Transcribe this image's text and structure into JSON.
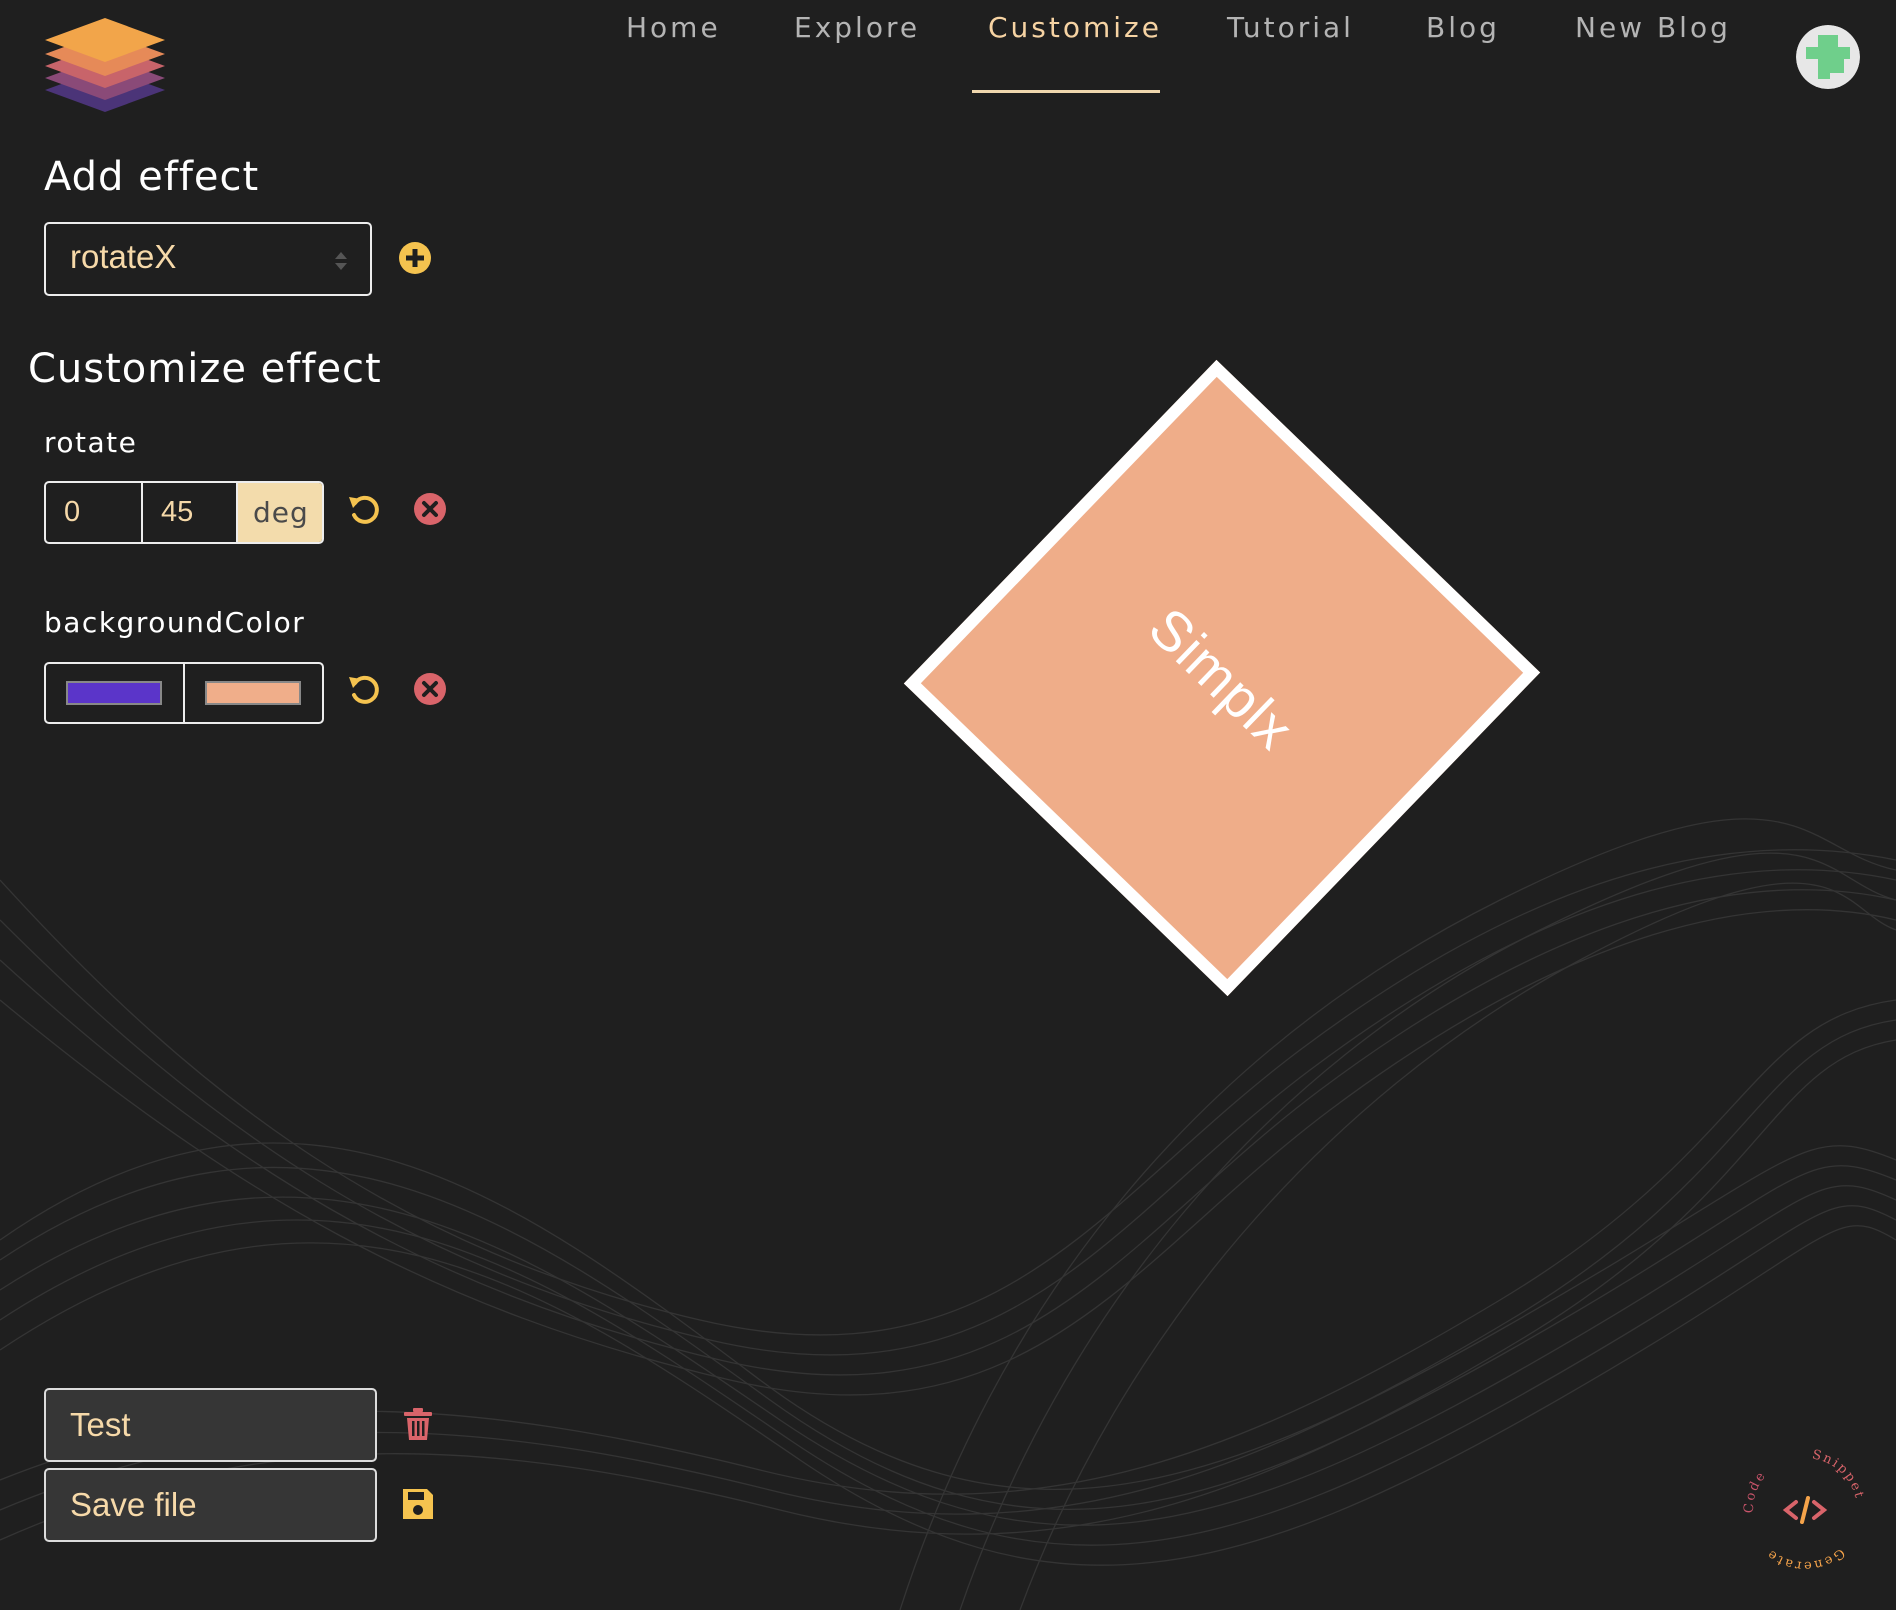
{
  "nav": {
    "items": [
      {
        "label": "Home"
      },
      {
        "label": "Explore"
      },
      {
        "label": "Customize"
      },
      {
        "label": "Tutorial"
      },
      {
        "label": "Blog"
      },
      {
        "label": "New Blog"
      }
    ],
    "active": "Customize"
  },
  "add_effect": {
    "title": "Add effect",
    "selected": "rotateX",
    "add_icon": "plus-circle-icon"
  },
  "customize": {
    "title": "Customize effect",
    "rotate": {
      "label": "rotate",
      "from": "0",
      "to": "45",
      "unit": "deg",
      "reset_icon": "undo-icon",
      "remove_icon": "close-circle-icon"
    },
    "background": {
      "label": "backgroundColor",
      "from_color": "#5b35c9",
      "to_color": "#f0ae8a",
      "reset_icon": "undo-icon",
      "remove_icon": "close-circle-icon"
    }
  },
  "bottom": {
    "name_value": "Test",
    "save_label": "Save file",
    "delete_icon": "trash-icon",
    "save_icon": "floppy-disk-icon"
  },
  "preview": {
    "text": "Simplx",
    "fill_color": "#efad89",
    "rotation_deg": 45
  },
  "badge": {
    "text_top": "Snippet",
    "text_left": "Code",
    "text_bottom": "Generate"
  },
  "colors": {
    "background": "#1f1f1f",
    "accent": "#f6d9a9",
    "icon_yellow": "#f5c34f",
    "icon_red": "#d9646a"
  }
}
